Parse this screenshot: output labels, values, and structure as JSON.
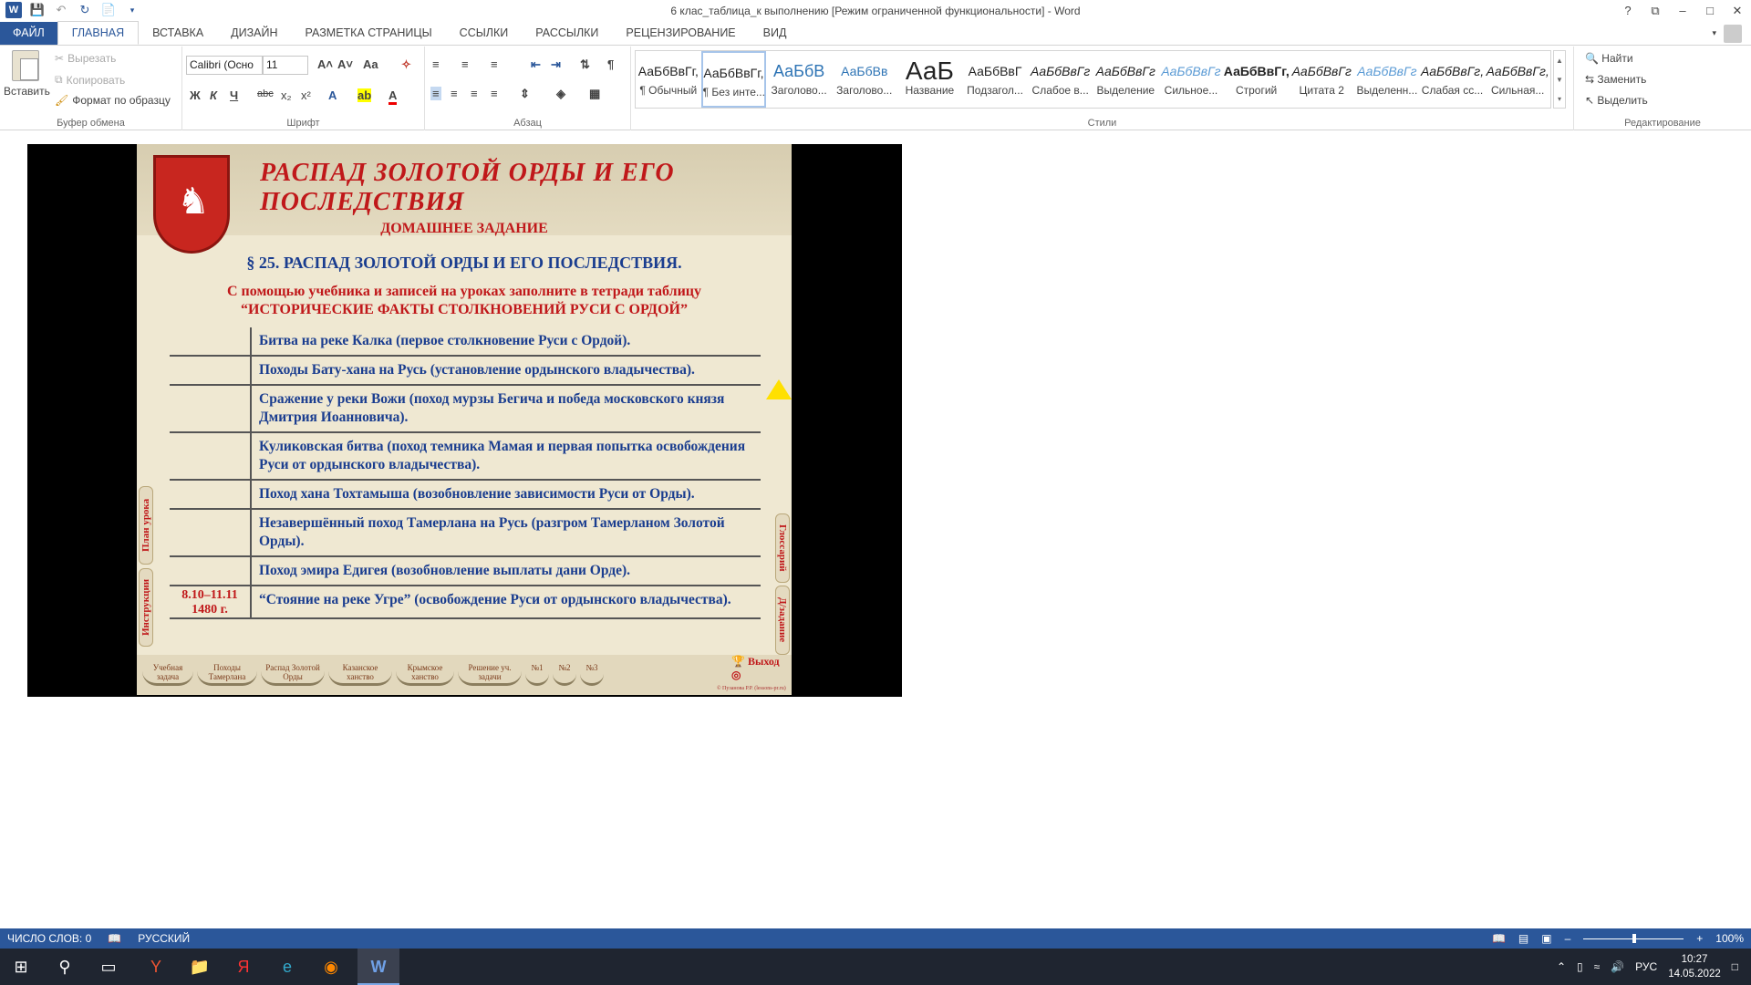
{
  "window": {
    "title": "6 клас_таблица_к выполнению [Режим ограниченной функциональности] - Word",
    "controls": [
      "?",
      "⧉",
      "–",
      "□",
      "✕"
    ]
  },
  "tabs": [
    "ФАЙЛ",
    "ГЛАВНАЯ",
    "ВСТАВКА",
    "ДИЗАЙН",
    "РАЗМЕТКА СТРАНИЦЫ",
    "ССЫЛКИ",
    "РАССЫЛКИ",
    "РЕЦЕНЗИРОВАНИЕ",
    "ВИД"
  ],
  "ribbon": {
    "clipboard": {
      "paste": "Вставить",
      "cut": "Вырезать",
      "copy": "Копировать",
      "format_painter": "Формат по образцу",
      "label": "Буфер обмена"
    },
    "font": {
      "family": "Calibri (Осно",
      "size": "11",
      "label": "Шрифт",
      "bold": "Ж",
      "italic": "К",
      "underline": "Ч",
      "strike": "abc",
      "sub": "x₂",
      "sup": "x²",
      "grow": "A˄",
      "shrink": "A˅",
      "case": "Aa",
      "effects": "A",
      "highlight": "ab",
      "color": "A"
    },
    "paragraph": {
      "label": "Абзац",
      "pilcrow": "¶"
    },
    "styles": {
      "label": "Стили",
      "items": [
        {
          "preview": "АаБбВвГг,",
          "name": "¶ Обычный"
        },
        {
          "preview": "АаБбВвГг,",
          "name": "¶ Без инте..."
        },
        {
          "preview": "АаБбВ",
          "name": "Заголово..."
        },
        {
          "preview": "АаБбВв",
          "name": "Заголово..."
        },
        {
          "preview": "АаБ",
          "name": "Название"
        },
        {
          "preview": "АаБбВвГ",
          "name": "Подзагол..."
        },
        {
          "preview": "АаБбВвГг",
          "name": "Слабое в..."
        },
        {
          "preview": "АаБбВвГг",
          "name": "Выделение"
        },
        {
          "preview": "АаБбВвГг",
          "name": "Сильное..."
        },
        {
          "preview": "АаБбВвГг,",
          "name": "Строгий"
        },
        {
          "preview": "АаБбВвГг",
          "name": "Цитата 2"
        },
        {
          "preview": "АаБбВвГг",
          "name": "Выделенн..."
        },
        {
          "preview": "АаБбВвГг,",
          "name": "Слабая сс..."
        },
        {
          "preview": "АаБбВвГг,",
          "name": "Сильная..."
        }
      ]
    },
    "editing": {
      "find": "Найти",
      "replace": "Заменить",
      "select": "Выделить",
      "label": "Редактирование"
    }
  },
  "slide": {
    "title": "РАСПАД ЗОЛОТОЙ ОРДЫ И ЕГО ПОСЛЕДСТВИЯ",
    "homework": "ДОМАШНЕЕ ЗАДАНИЕ",
    "section": "§ 25. РАСПАД ЗОЛОТОЙ ОРДЫ И ЕГО ПОСЛЕДСТВИЯ.",
    "instruction1": "С помощью учебника и записей на уроках заполните в тетради таблицу",
    "instruction2": "“ИСТОРИЧЕСКИЕ ФАКТЫ СТОЛКНОВЕНИЙ РУСИ С ОРДОЙ”",
    "rows": [
      {
        "date": "",
        "text": "Битва на реке Калка (первое столкновение Руси с Ордой)."
      },
      {
        "date": "",
        "text": "Походы Бату-хана на Русь (установление ордынского владычества)."
      },
      {
        "date": "",
        "text": "Сражение у реки Вожи (поход мурзы Бегича и победа московского князя Дмитрия Иоанновича)."
      },
      {
        "date": "",
        "text": "Куликовская битва (поход темника Мамая и первая попытка освобождения Руси от ордынского владычества)."
      },
      {
        "date": "",
        "text": "Поход хана Тохтамыша (возобновление зависимости Руси от Орды)."
      },
      {
        "date": "",
        "text": "Незавершённый поход Тамерлана на Русь (разгром Тамерланом Золотой Орды)."
      },
      {
        "date": "",
        "text": "Поход эмира Едигея (возобновление выплаты дани Орде)."
      },
      {
        "date": "8.10–11.11 1480 г.",
        "text": "“Стояние на реке Угре” (освобождение Руси от ордынского владычества)."
      }
    ],
    "left_tabs": [
      "План урока",
      "Инструкции"
    ],
    "right_tabs": [
      "Глоссарий",
      "Д/задание"
    ],
    "nav": [
      "Учебная задача",
      "Походы Тамерлана",
      "Распад Золотой Орды",
      "Казанское ханство",
      "Крымское ханство",
      "Решение уч. задачи",
      "№1",
      "№2",
      "№3"
    ],
    "exit": "Выход",
    "copyright": "© Пузанова Р.Р. (lessons-pr.ru)"
  },
  "status": {
    "words": "ЧИСЛО СЛОВ: 0",
    "language": "РУССКИЙ",
    "zoom": "100%"
  },
  "taskbar": {
    "lang": "РУС",
    "time": "10:27",
    "date": "14.05.2022"
  }
}
